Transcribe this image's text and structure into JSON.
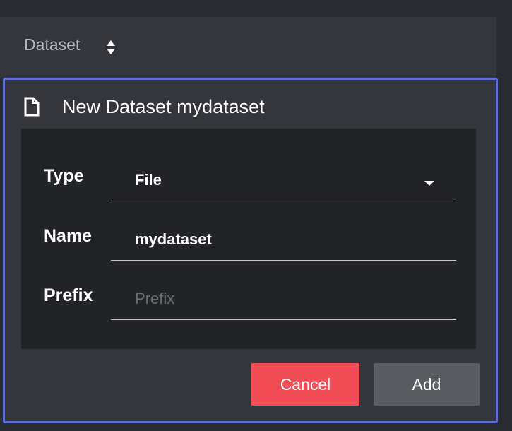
{
  "header": {
    "label": "Dataset",
    "sort_icon": "sort-updown-icon"
  },
  "panel": {
    "title_icon": "file-icon",
    "title": "New Dataset mydataset"
  },
  "form": {
    "type": {
      "label": "Type",
      "value": "File",
      "icon": "chevron-down-icon"
    },
    "name": {
      "label": "Name",
      "value": "mydataset"
    },
    "prefix": {
      "label": "Prefix",
      "value": "",
      "placeholder": "Prefix"
    }
  },
  "actions": {
    "cancel_label": "Cancel",
    "add_label": "Add"
  },
  "colors": {
    "panel_border": "#5d6fd0",
    "cancel_bg": "#f24d55",
    "add_bg": "#595c61"
  }
}
